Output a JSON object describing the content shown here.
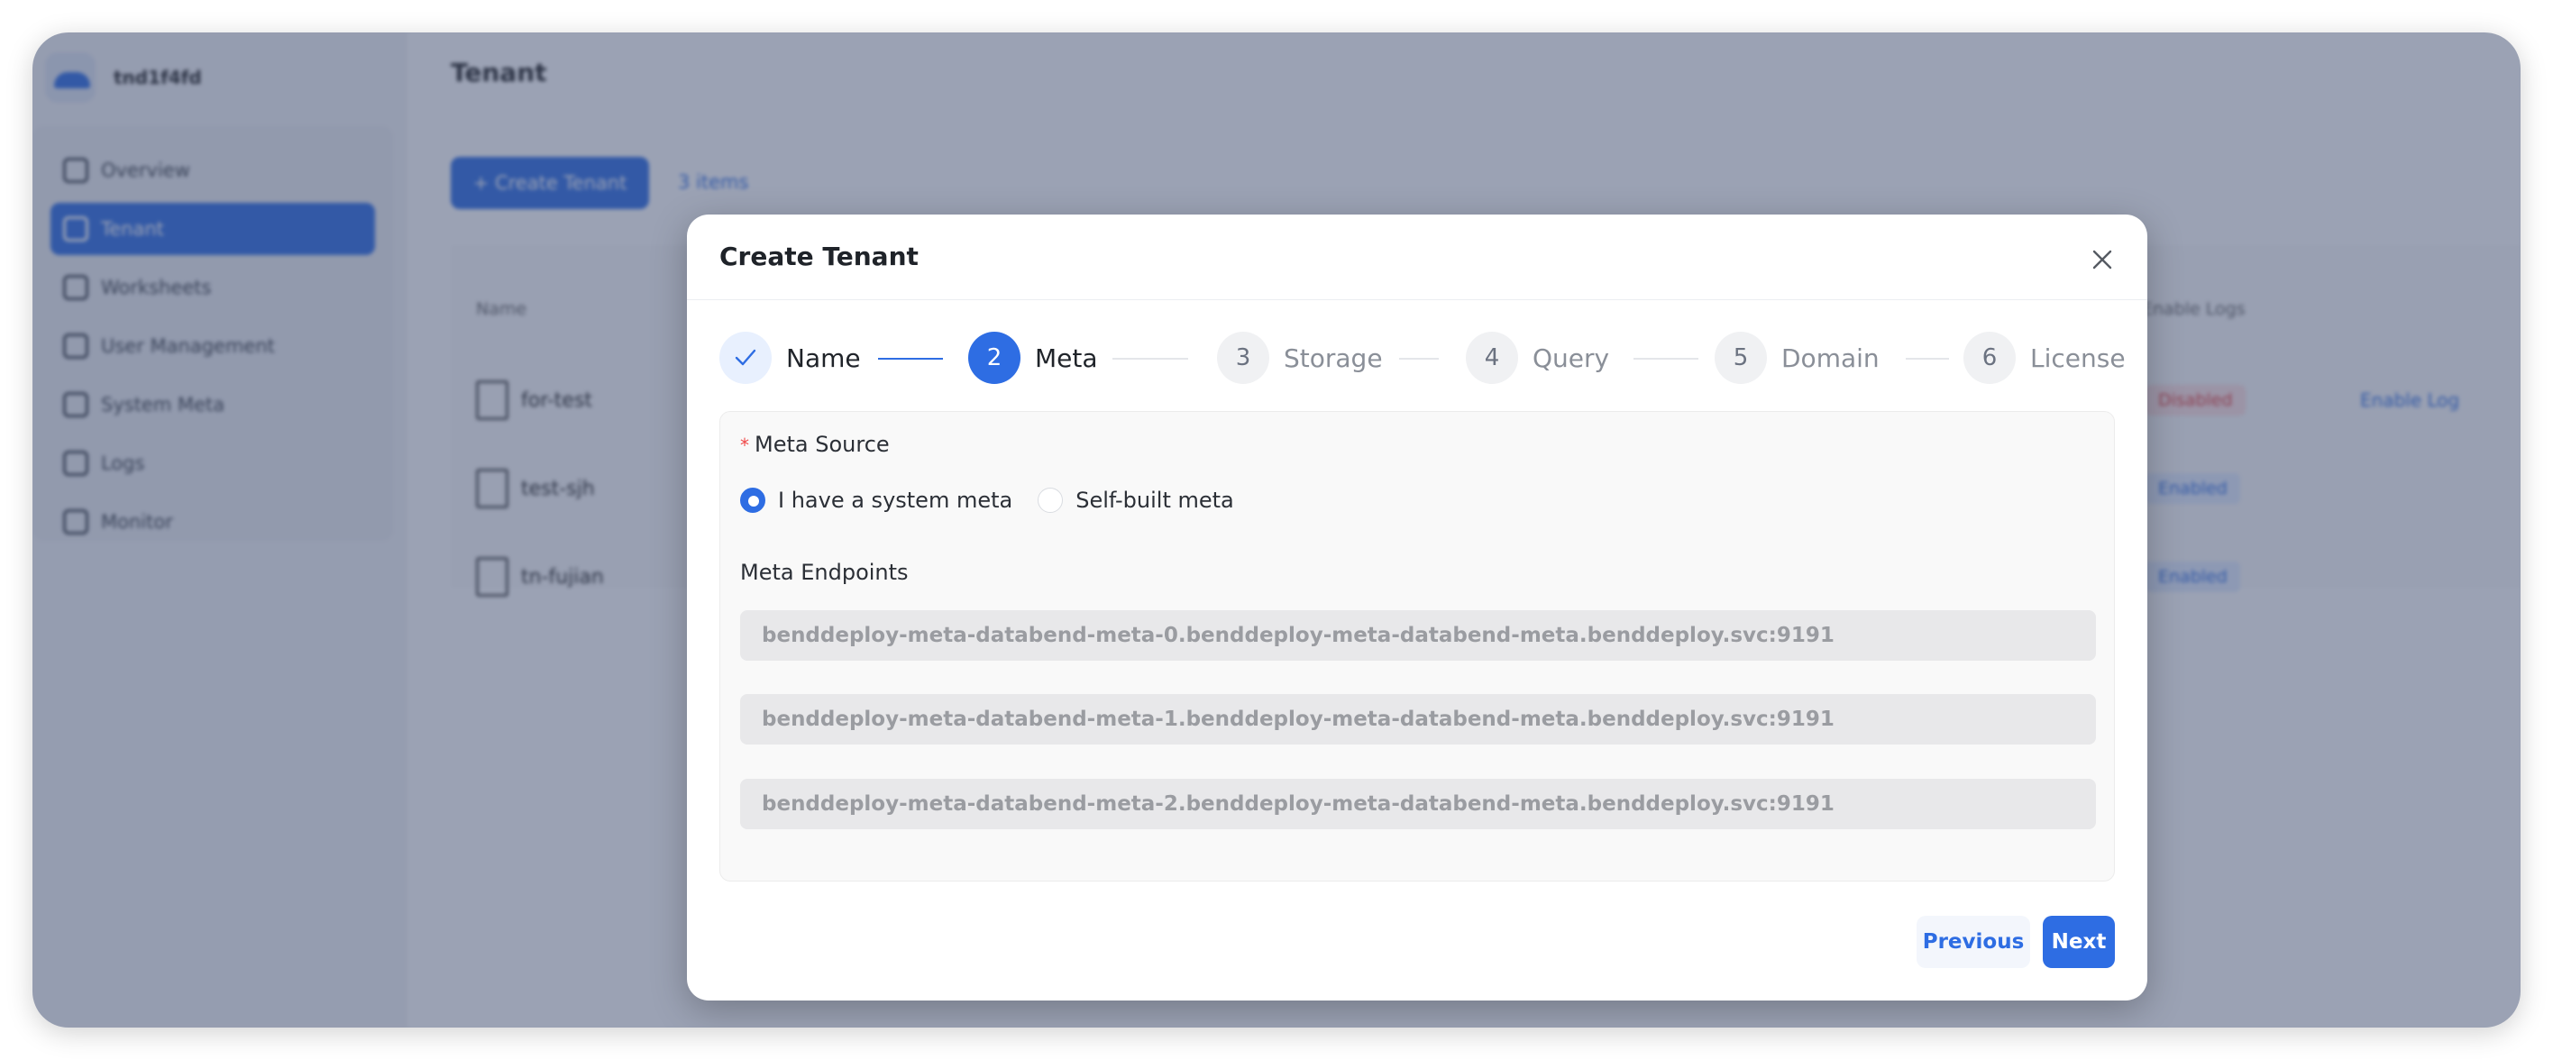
{
  "app": {
    "brand_name": "tnd1f4fd",
    "page_title": "Tenant",
    "create_button": "+ Create Tenant",
    "items_count_link": "3 items",
    "sidebar": {
      "items": [
        {
          "label": "Overview",
          "icon": "overview-icon"
        },
        {
          "label": "Tenant",
          "icon": "tenant-icon",
          "active": true
        },
        {
          "label": "Worksheets",
          "icon": "worksheets-icon"
        },
        {
          "label": "User Management",
          "icon": "user-icon"
        },
        {
          "label": "System Meta",
          "icon": "system-meta-icon"
        },
        {
          "label": "Logs",
          "icon": "logs-icon"
        },
        {
          "label": "Monitor",
          "icon": "monitor-icon"
        }
      ]
    },
    "table": {
      "columns": [
        "Name",
        "Enable Logs"
      ],
      "rows": [
        {
          "name": "for-test",
          "status": "Disabled",
          "action": "Enable Log"
        },
        {
          "name": "test-sjh",
          "status": "Enabled"
        },
        {
          "name": "tn-fujian",
          "status": "Enabled"
        }
      ]
    }
  },
  "modal": {
    "title": "Create Tenant",
    "steps": [
      {
        "number": "",
        "label": "Name",
        "state": "done"
      },
      {
        "number": "2",
        "label": "Meta",
        "state": "active"
      },
      {
        "number": "3",
        "label": "Storage",
        "state": "todo"
      },
      {
        "number": "4",
        "label": "Query",
        "state": "todo"
      },
      {
        "number": "5",
        "label": "Domain",
        "state": "todo"
      },
      {
        "number": "6",
        "label": "License",
        "state": "todo"
      }
    ],
    "meta_source_label": "Meta Source",
    "radio_options": [
      {
        "label": "I have a system meta",
        "checked": true
      },
      {
        "label": "Self-built meta",
        "checked": false
      }
    ],
    "meta_endpoints_label": "Meta Endpoints",
    "endpoints": [
      "benddeploy-meta-databend-meta-0.benddeploy-meta-databend-meta.benddeploy.svc:9191",
      "benddeploy-meta-databend-meta-1.benddeploy-meta-databend-meta.benddeploy.svc:9191",
      "benddeploy-meta-databend-meta-2.benddeploy-meta-databend-meta.benddeploy.svc:9191"
    ],
    "previous_label": "Previous",
    "next_label": "Next"
  },
  "colors": {
    "accent": "#2e6de3",
    "overlay": "#374669",
    "required": "#f04848"
  }
}
